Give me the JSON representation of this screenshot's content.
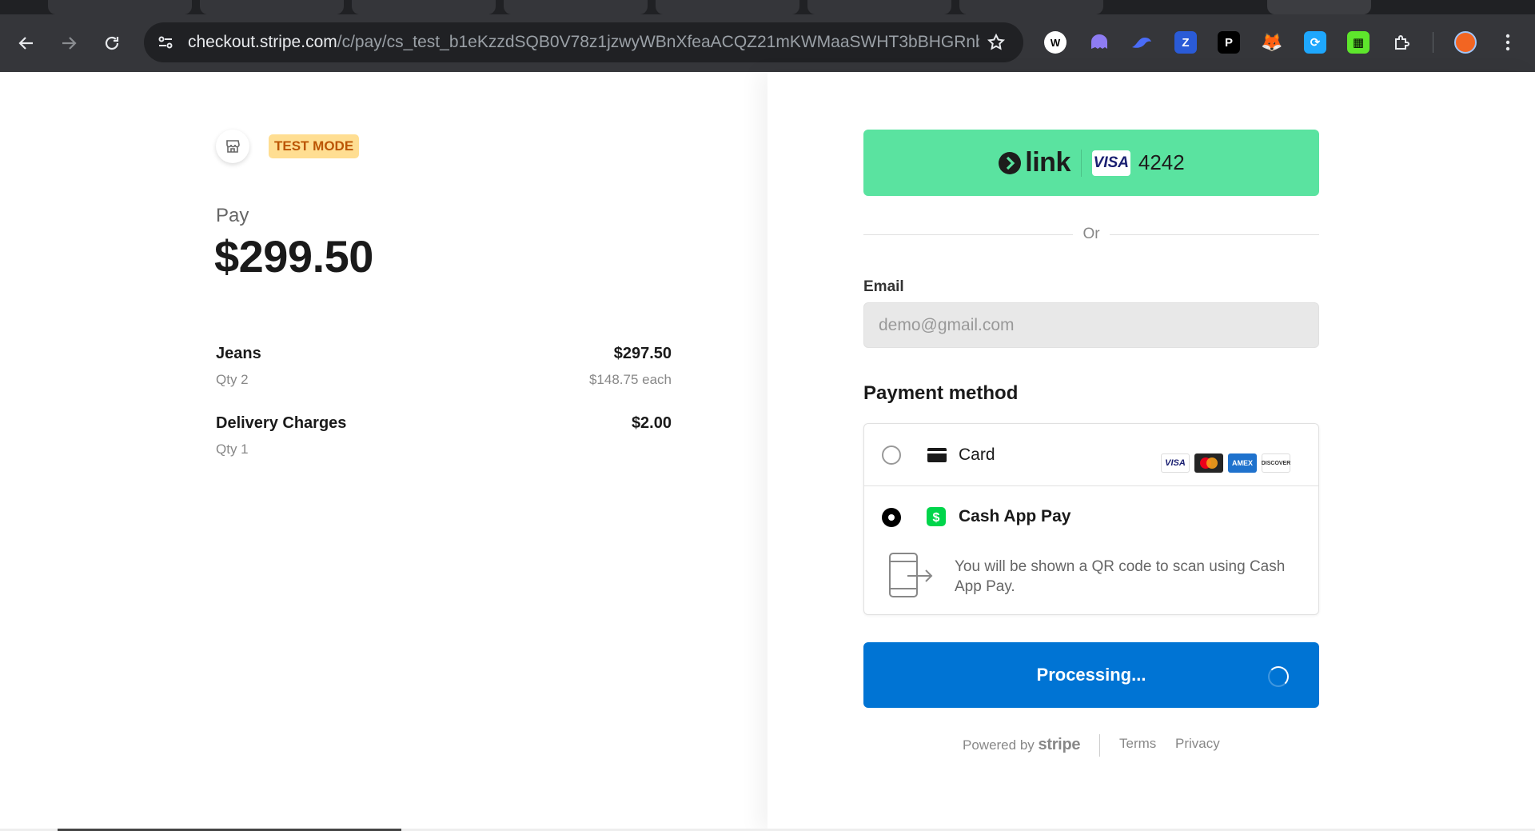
{
  "browser": {
    "url_host": "checkout.stripe.com",
    "url_path": "/c/pay/cs_test_b1eKzzdSQB0V78z1jzwyWBnXfeaACQZ21mKWMaaSWHT3bBHGRnb...",
    "extensions": [
      "wordpress-icon",
      "ghost-icon",
      "bird-icon",
      "zotero-icon",
      "p-icon",
      "metamask-icon",
      "refresh-ext-icon",
      "game-icon",
      "puzzle-icon"
    ]
  },
  "merchant": {
    "test_mode_label": "TEST MODE",
    "pay_label": "Pay",
    "total": "$299.50"
  },
  "line_items": [
    {
      "name": "Jeans",
      "qty": "Qty 2",
      "price": "$297.50",
      "each": "$148.75 each"
    },
    {
      "name": "Delivery Charges",
      "qty": "Qty 1",
      "price": "$2.00",
      "each": ""
    }
  ],
  "link_button": {
    "brand": "link",
    "card_brand": "VISA",
    "last4": "4242"
  },
  "or_text": "Or",
  "email": {
    "label": "Email",
    "value": "demo@gmail.com"
  },
  "payment": {
    "title": "Payment method",
    "card_label": "Card",
    "card_brands": [
      "VISA",
      "MC",
      "AMEX",
      "DISCOVER"
    ],
    "cashapp_label": "Cash App Pay",
    "cashapp_desc": "You will be shown a QR code to scan using Cash App Pay.",
    "selected": "cashapp"
  },
  "submit": {
    "label": "Processing..."
  },
  "footer": {
    "powered_by": "Powered by",
    "brand": "stripe",
    "terms": "Terms",
    "privacy": "Privacy"
  },
  "colors": {
    "link_green": "#5ae3a0",
    "submit_blue": "#0074d4",
    "test_badge_bg": "#ffde92",
    "test_badge_fg": "#bb5504",
    "cashapp_green": "#00d54b"
  }
}
